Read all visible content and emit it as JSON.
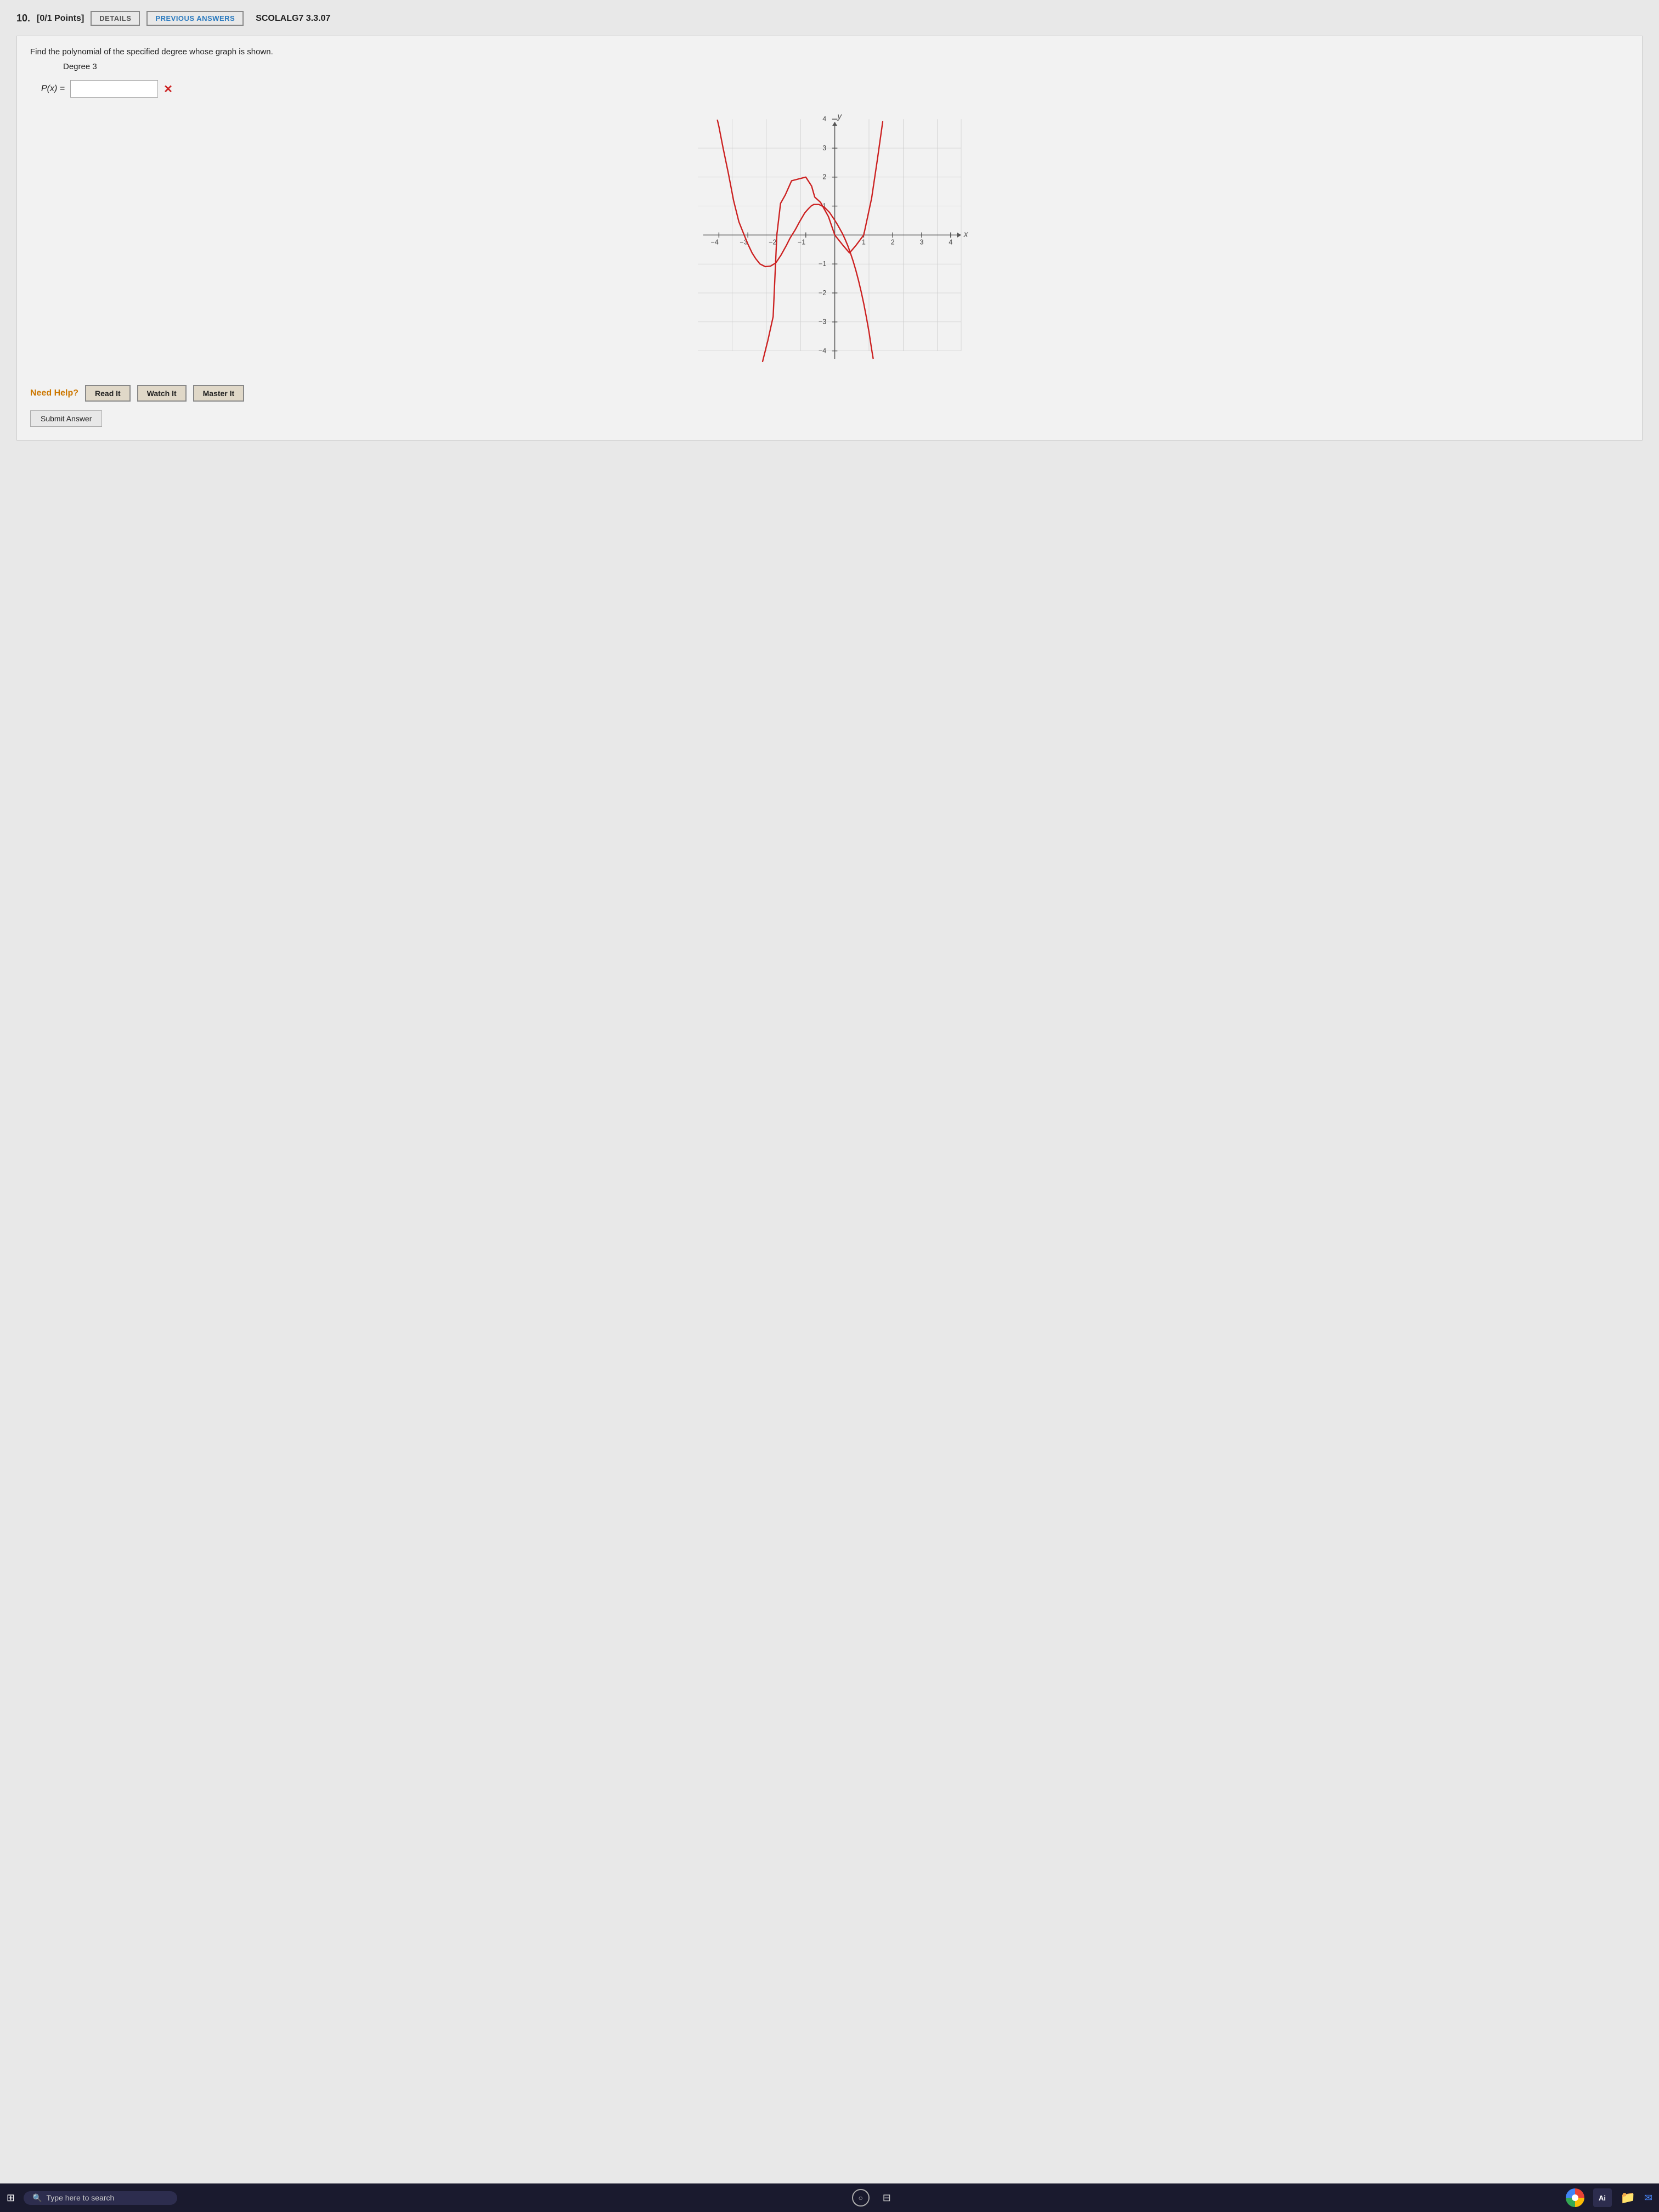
{
  "header": {
    "question_number": "10.",
    "points": "[0/1 Points]",
    "details_label": "DETAILS",
    "prev_answers_label": "PREVIOUS ANSWERS",
    "question_code": "SCOLALG7 3.3.07"
  },
  "question": {
    "instruction": "Find the polynomial of the specified degree whose graph is shown.",
    "degree_label": "Degree 3",
    "px_label": "P(x) =",
    "px_input_value": "",
    "px_input_placeholder": "",
    "error_mark": "✕"
  },
  "graph": {
    "x_label": "x",
    "y_label": "y",
    "x_min": -4,
    "x_max": 4,
    "y_min": -4,
    "y_max": 4
  },
  "help": {
    "label": "Need Help?",
    "read_it": "Read It",
    "watch_it": "Watch It",
    "master_it": "Master It"
  },
  "submit": {
    "label": "Submit Answer"
  },
  "taskbar": {
    "search_placeholder": "Type here to search",
    "ai_label": "Ai"
  }
}
